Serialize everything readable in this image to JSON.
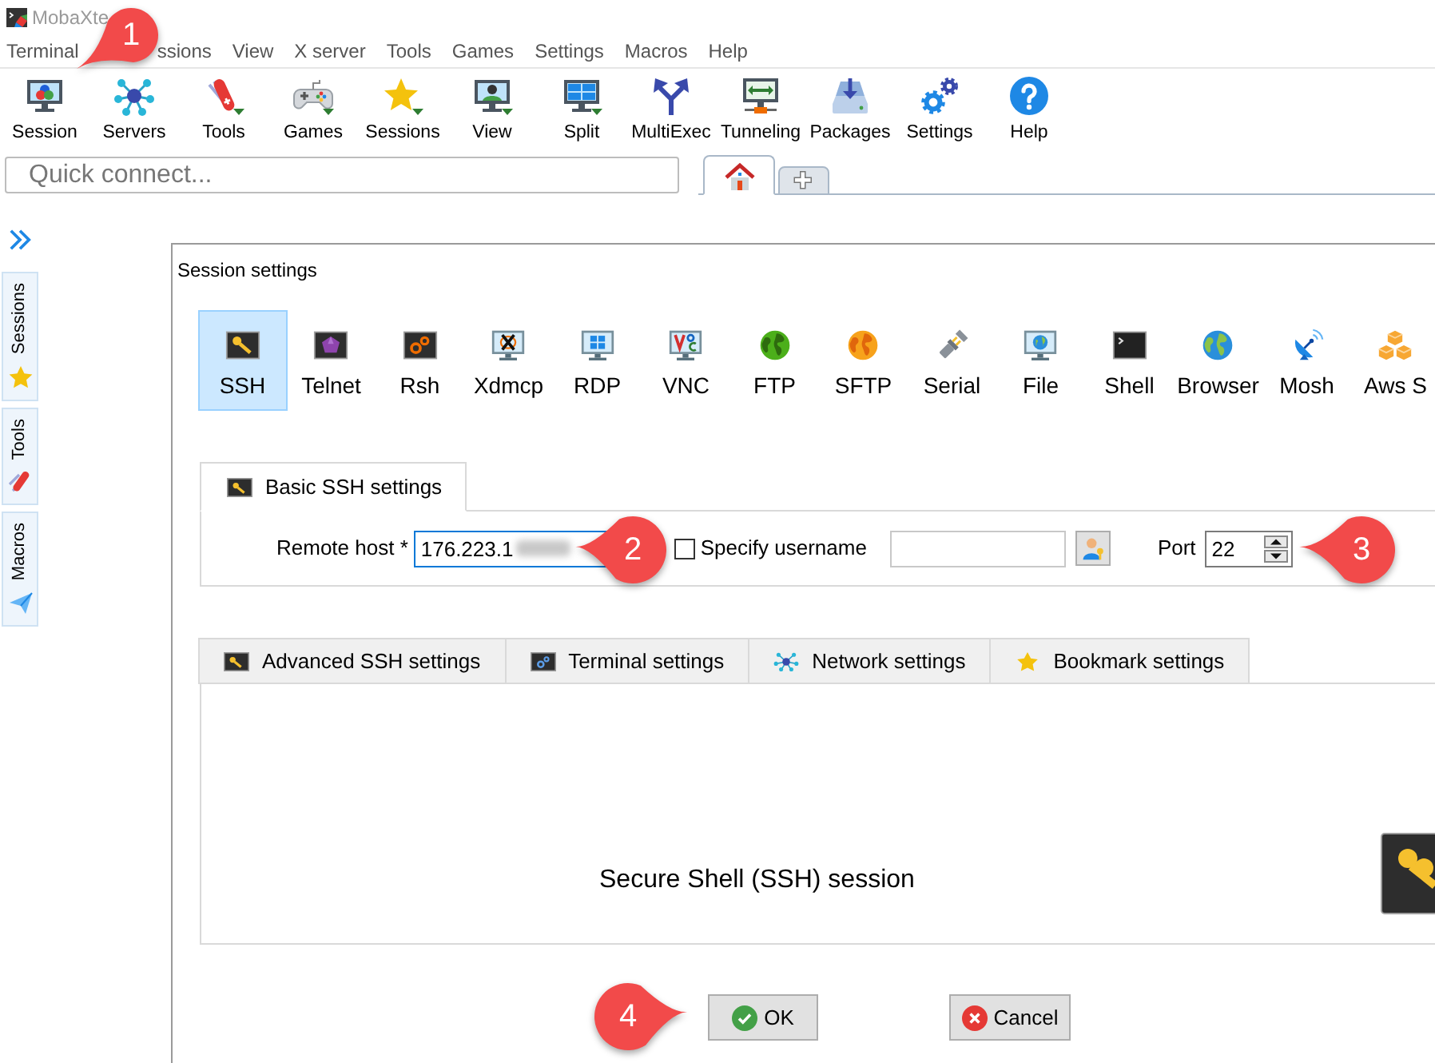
{
  "window": {
    "title": "MobaXte"
  },
  "menu": [
    {
      "label": "Terminal"
    },
    {
      "label": "ssions"
    },
    {
      "label": "View"
    },
    {
      "label": "X server"
    },
    {
      "label": "Tools"
    },
    {
      "label": "Games"
    },
    {
      "label": "Settings"
    },
    {
      "label": "Macros"
    },
    {
      "label": "Help"
    }
  ],
  "toolbar": [
    {
      "label": "Session"
    },
    {
      "label": "Servers"
    },
    {
      "label": "Tools"
    },
    {
      "label": "Games"
    },
    {
      "label": "Sessions"
    },
    {
      "label": "View"
    },
    {
      "label": "Split"
    },
    {
      "label": "MultiExec"
    },
    {
      "label": "Tunneling"
    },
    {
      "label": "Packages"
    },
    {
      "label": "Settings"
    },
    {
      "label": "Help"
    }
  ],
  "quick_connect": {
    "placeholder": "Quick connect..."
  },
  "tabs": [
    {
      "selected": true
    },
    {
      "selected": false
    }
  ],
  "sidebar": {
    "tabs": [
      {
        "label": "Sessions",
        "selected": false
      },
      {
        "label": "Tools",
        "selected": false
      },
      {
        "label": "Macros",
        "selected": false
      }
    ]
  },
  "dialog": {
    "title": "Session settings",
    "session_types": [
      {
        "label": "SSH",
        "selected": true
      },
      {
        "label": "Telnet",
        "selected": false
      },
      {
        "label": "Rsh",
        "selected": false
      },
      {
        "label": "Xdmcp",
        "selected": false
      },
      {
        "label": "RDP",
        "selected": false
      },
      {
        "label": "VNC",
        "selected": false
      },
      {
        "label": "FTP",
        "selected": false
      },
      {
        "label": "SFTP",
        "selected": false
      },
      {
        "label": "Serial",
        "selected": false
      },
      {
        "label": "File",
        "selected": false
      },
      {
        "label": "Shell",
        "selected": false
      },
      {
        "label": "Browser",
        "selected": false
      },
      {
        "label": "Mosh",
        "selected": false
      },
      {
        "label": "Aws S",
        "selected": false
      }
    ],
    "basic_tabs": [
      {
        "label": "Basic SSH settings",
        "selected": true
      }
    ],
    "remote_host": {
      "label": "Remote host *",
      "value": "176.223.1"
    },
    "specify_username": {
      "label": "Specify username",
      "checked": false
    },
    "port": {
      "label": "Port",
      "value": "22"
    },
    "advanced_tabs": [
      {
        "label": "Advanced SSH settings",
        "selected": false
      },
      {
        "label": "Terminal settings",
        "selected": false
      },
      {
        "label": "Network settings",
        "selected": false
      },
      {
        "label": "Bookmark settings",
        "selected": false
      }
    ],
    "description": "Secure Shell (SSH) session",
    "buttons": [
      {
        "label": "OK"
      },
      {
        "label": "Cancel"
      }
    ]
  },
  "callouts": [
    {
      "label": "1"
    },
    {
      "label": "2"
    },
    {
      "label": "3"
    },
    {
      "label": "4"
    }
  ]
}
